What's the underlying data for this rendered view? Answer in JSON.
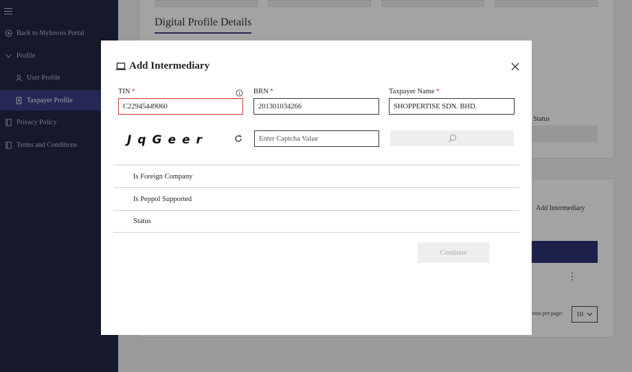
{
  "sidebar": {
    "items": [
      {
        "label": "Back to MyInvois Portal",
        "icon": "back-circle-icon"
      },
      {
        "label": "Profile",
        "icon": "chevron-down-icon"
      },
      {
        "label": "User Profile",
        "icon": "user-icon"
      },
      {
        "label": "Taxpayer Profile",
        "icon": "document-icon",
        "active": true
      },
      {
        "label": "Privacy Policy",
        "icon": "book-icon"
      },
      {
        "label": "Terms and Conditions",
        "icon": "book-icon"
      }
    ]
  },
  "background": {
    "section_title": "Digital Profile Details",
    "status_label": "Status",
    "add_intermediary_label": "Add Intermediary",
    "items_per_page_label": "Items per page:",
    "items_per_page_value": "10"
  },
  "modal": {
    "title": "Add Intermediary",
    "tin": {
      "label": "TIN",
      "required": "*",
      "value": "C22945449060",
      "state": "error"
    },
    "brn": {
      "label": "BRN",
      "required": "*",
      "value": "201301034266"
    },
    "taxpayer_name": {
      "label": "Taxpayer Name",
      "required": "*",
      "value": "SHOPPERTISE SDN. BHD."
    },
    "captcha": {
      "text": "JqGeer",
      "placeholder": "Enter Captcha Value"
    },
    "rows": [
      {
        "label": "Is Foreign Company"
      },
      {
        "label": "Is Peppol Supported"
      },
      {
        "label": "Status"
      }
    ],
    "continue_label": "Continue"
  },
  "colors": {
    "sidebar_bg": "#232845",
    "sidebar_active": "#3a3f86",
    "accent": "#2f3378",
    "error": "#d0342c"
  }
}
